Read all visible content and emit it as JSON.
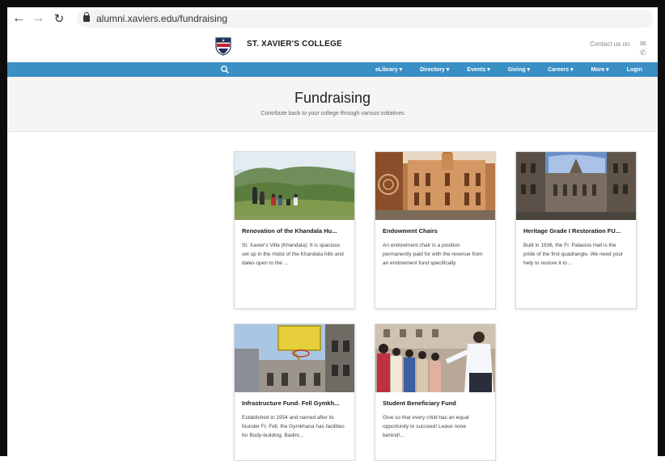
{
  "browser": {
    "url": "alumni.xaviers.edu/fundraising"
  },
  "header": {
    "college_name": "ST. XAVIER'S COLLEGE",
    "contact_label": "Contact us on"
  },
  "nav": {
    "items": [
      {
        "label": "eLibrary ▾"
      },
      {
        "label": "Directory ▾"
      },
      {
        "label": "Events ▾"
      },
      {
        "label": "Giving ▾"
      },
      {
        "label": "Careers ▾"
      },
      {
        "label": "More ▾"
      },
      {
        "label": "Login"
      }
    ]
  },
  "hero": {
    "title": "Fundraising",
    "subtitle": "Contribute back to your college through various initiatives"
  },
  "cards": [
    {
      "title": "Renovation of the Khandala Hu...",
      "text": "St. Xavier's Villa (Khandala): It is spacious set up in the midst of the Khandala hills and dales open to the ..."
    },
    {
      "title": "Endowment Chairs",
      "text": "An endowment chair is a position permanently paid for with the revenue from an endowment fund specifically"
    },
    {
      "title": "Heritage Grade I Restoration FU...",
      "text": "Built in 1936, the Fr. Palacios Hall is the pride of the first quadrangle. We need your help to restore it to ..."
    },
    {
      "title": "Infrastructure Fund- Fell Gymkh...",
      "text": "Established in 1954 and named after its founder Fr. Fell, the Gymkhana has facilities for Body-building, Badmi..."
    },
    {
      "title": "Student Beneficiary Fund",
      "text": "Give so that every child has an equal opportunity to succeed! Leave none behind!..."
    }
  ],
  "colors": {
    "navbar": "#3a8fc4",
    "hero_bg": "#f5f5f6"
  }
}
